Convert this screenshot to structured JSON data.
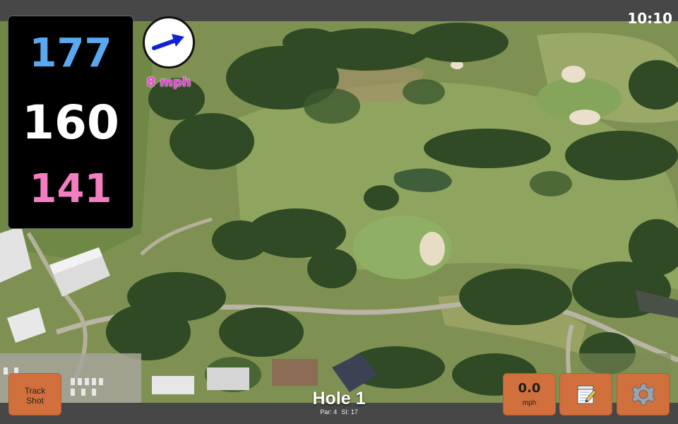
{
  "status_bar": {
    "time": "10:10"
  },
  "distances": {
    "back": "177",
    "middle": "160",
    "front": "141",
    "colors": {
      "back": "#5aa9f0",
      "middle": "#ffffff",
      "front": "#f27ec0"
    }
  },
  "wind": {
    "speed_label": "8 mph",
    "direction_icon": "arrow-icon",
    "arrow_color": "#1021d8",
    "label_color": "#ec3fd6"
  },
  "buttons": {
    "track_shot": [
      "Track",
      "Shot"
    ],
    "speed": {
      "value": "0.0",
      "unit": "mph"
    },
    "notes_icon": "notepad-icon",
    "settings_icon": "gear-icon",
    "color": "#d2703d"
  },
  "hole": {
    "title": "Hole 1",
    "par": "Par: 4",
    "stroke_index": "SI: 17"
  }
}
